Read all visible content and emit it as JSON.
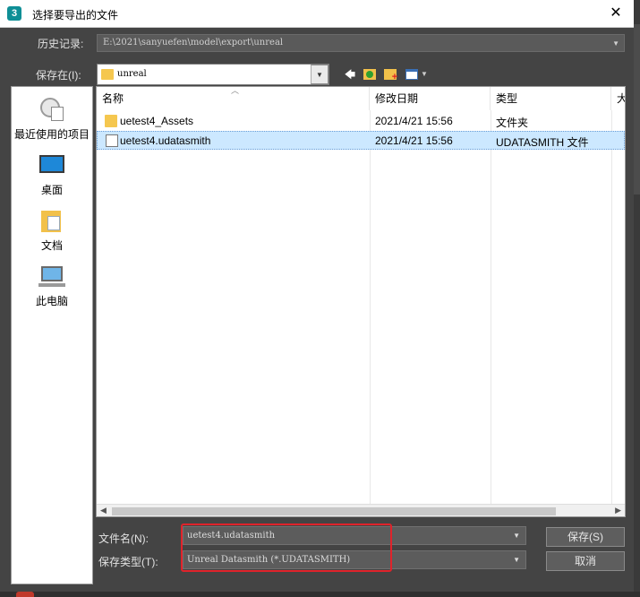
{
  "window": {
    "app_icon_glyph": "3",
    "title": "选择要导出的文件",
    "close_glyph": "✕"
  },
  "history": {
    "label": "历史记录:",
    "value": "E:\\2021\\sanyuefen\\model\\export\\unreal"
  },
  "save_in": {
    "label": "保存在(I):",
    "value": "unreal"
  },
  "toolbar": {
    "back_glyph": "🡄"
  },
  "places": [
    {
      "label": "最近使用的项目",
      "icon": "recent-items-icon"
    },
    {
      "label": "桌面",
      "icon": "desktop-icon"
    },
    {
      "label": "文档",
      "icon": "documents-icon"
    },
    {
      "label": "此电脑",
      "icon": "this-pc-icon"
    }
  ],
  "columns": {
    "name": "名称",
    "modified": "修改日期",
    "type": "类型",
    "size": "大"
  },
  "files": [
    {
      "name": "uetest4_Assets",
      "modified": "2021/4/21 15:56",
      "type": "文件夹",
      "icon": "folder-icon",
      "selected": false
    },
    {
      "name": "uetest4.udatasmith",
      "modified": "2021/4/21 15:56",
      "type": "UDATASMITH 文件",
      "icon": "file-icon",
      "selected": true
    }
  ],
  "filename": {
    "label": "文件名(N):",
    "value": "uetest4.udatasmith"
  },
  "filetype": {
    "label": "保存类型(T):",
    "value": "Unreal Datasmith (*.UDATASMITH)"
  },
  "buttons": {
    "save": "保存(S)",
    "cancel": "取消"
  },
  "colors": {
    "highlight_box": "#e0232b",
    "selection": "#cce8ff",
    "folder": "#f5c74f"
  }
}
